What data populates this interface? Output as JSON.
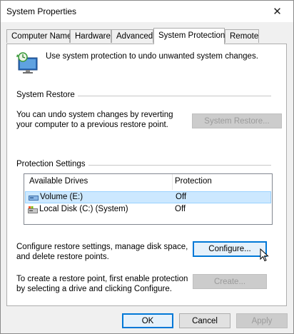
{
  "window": {
    "title": "System Properties"
  },
  "tabs": [
    {
      "label": "Computer Name"
    },
    {
      "label": "Hardware"
    },
    {
      "label": "Advanced"
    },
    {
      "label": "System Protection"
    },
    {
      "label": "Remote"
    }
  ],
  "intro": {
    "text": "Use system protection to undo unwanted system changes."
  },
  "system_restore": {
    "title": "System Restore",
    "description": "You can undo system changes by reverting\nyour computer to a previous restore point.",
    "button": "System Restore..."
  },
  "protection": {
    "title": "Protection Settings",
    "columns": [
      "Available Drives",
      "Protection"
    ],
    "drives": [
      {
        "name": "Volume (E:)",
        "protection": "Off",
        "selected": true
      },
      {
        "name": "Local Disk (C:) (System)",
        "protection": "Off",
        "selected": false
      }
    ],
    "configure_text": "Configure restore settings, manage disk space,\nand delete restore points.",
    "configure_button": "Configure...",
    "create_text": "To create a restore point, first enable protection\nby selecting a drive and clicking Configure.",
    "create_button": "Create..."
  },
  "footer": {
    "ok": "OK",
    "cancel": "Cancel",
    "apply": "Apply"
  },
  "colors": {
    "accent": "#0078d7",
    "selection": "#cce8ff"
  }
}
